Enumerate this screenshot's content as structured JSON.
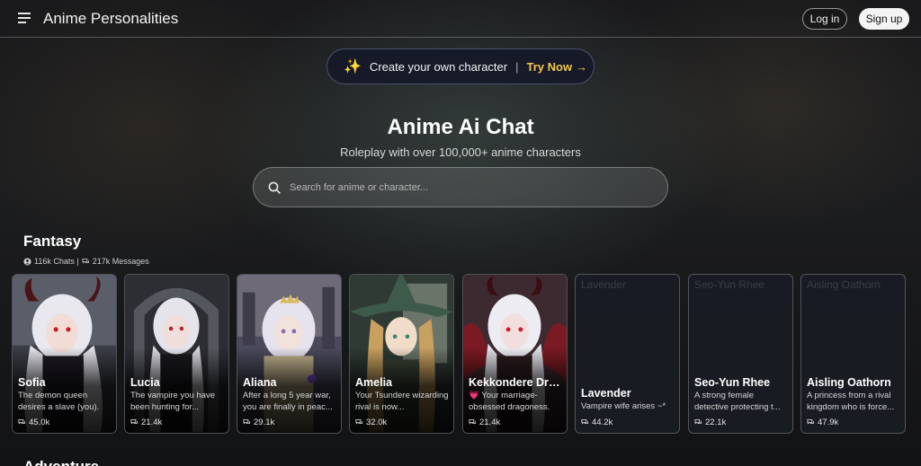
{
  "header": {
    "title": "Anime Personalities",
    "login_label": "Log in",
    "signup_label": "Sign up"
  },
  "promo": {
    "text": "Create your own character",
    "separator": "|",
    "cta": "Try Now",
    "cta_arrow": "→"
  },
  "hero": {
    "title": "Anime Ai Chat",
    "subtitle": "Roleplay with over 100,000+ anime characters"
  },
  "search": {
    "placeholder": "Search for anime or character..."
  },
  "sections": [
    {
      "title": "Fantasy",
      "stats": "116k Chats | ",
      "stats_messages": "217k Messages",
      "cards": [
        {
          "name": "Sofia",
          "desc": "The demon queen desires a slave (you).",
          "count": "45.0k",
          "alt": ""
        },
        {
          "name": "Lucia",
          "desc": "The vampire you have been hunting for...",
          "count": "21.4k",
          "alt": ""
        },
        {
          "name": "Aliana",
          "desc": "After a long 5 year war, you are finally in peac...",
          "count": "29.1k",
          "alt": ""
        },
        {
          "name": "Amelia",
          "desc": "Your Tsundere wizarding rival is now...",
          "count": "32.0k",
          "alt": ""
        },
        {
          "name": "Kekkondere Dra...",
          "desc": "💗 Your marriage-obsessed dragoness.",
          "count": "21.4k",
          "alt": ""
        },
        {
          "name": "Lavender",
          "desc": "Vampire wife arises ~*",
          "count": "44.2k",
          "alt": "Lavender"
        },
        {
          "name": "Seo-Yun Rhee",
          "desc": "A strong female detective protecting t...",
          "count": "22.1k",
          "alt": "Seo-Yun Rhee"
        },
        {
          "name": "Aisling Oathorn",
          "desc": "A princess from a rival kingdom who is force...",
          "count": "47.9k",
          "alt": "Aisling Oathorn"
        }
      ]
    },
    {
      "title": "Adventure"
    }
  ],
  "colors": {
    "accent": "#f2c84b",
    "pill_border": "#78829a"
  }
}
